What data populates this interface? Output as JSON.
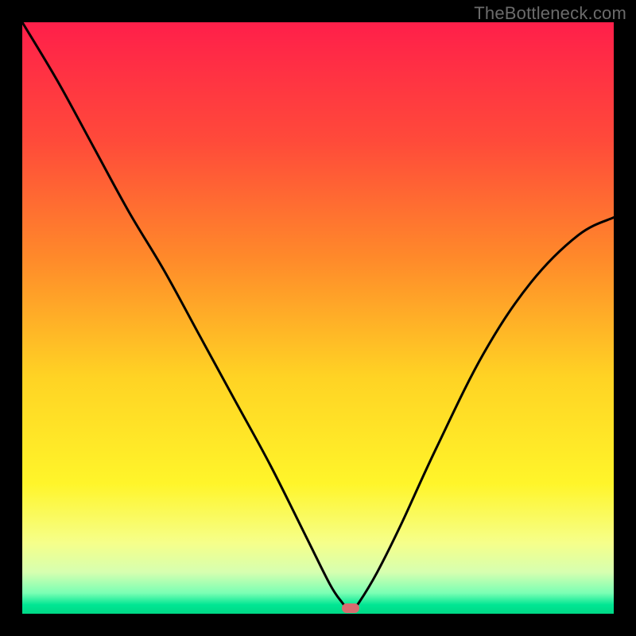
{
  "watermark": "TheBottleneck.com",
  "colors": {
    "frame": "#000000",
    "curve": "#000000",
    "marker": "#d96b6f",
    "gradient_stops": [
      {
        "offset": 0.0,
        "color": "#ff1f4a"
      },
      {
        "offset": 0.2,
        "color": "#ff4a3a"
      },
      {
        "offset": 0.4,
        "color": "#ff8a2a"
      },
      {
        "offset": 0.6,
        "color": "#ffd324"
      },
      {
        "offset": 0.78,
        "color": "#fff52a"
      },
      {
        "offset": 0.88,
        "color": "#f6ff8a"
      },
      {
        "offset": 0.93,
        "color": "#d6ffb0"
      },
      {
        "offset": 0.965,
        "color": "#7affb4"
      },
      {
        "offset": 0.985,
        "color": "#00e693"
      },
      {
        "offset": 1.0,
        "color": "#00d986"
      }
    ]
  },
  "chart_data": {
    "type": "line",
    "title": "",
    "xlabel": "",
    "ylabel": "",
    "xlim": [
      0,
      100
    ],
    "ylim": [
      0,
      100
    ],
    "grid": false,
    "x": [
      0,
      6,
      12,
      18,
      24,
      30,
      36,
      42,
      48,
      52,
      54,
      55,
      56,
      57,
      60,
      64,
      70,
      78,
      86,
      94,
      100
    ],
    "values": [
      100,
      90,
      79,
      68,
      58,
      47,
      36,
      25,
      13,
      5,
      2,
      1,
      1,
      2,
      7,
      15,
      28,
      44,
      56,
      64,
      67
    ],
    "minimum": {
      "x": 55.5,
      "y": 1
    },
    "marker_xy": [
      55.5,
      1
    ]
  }
}
